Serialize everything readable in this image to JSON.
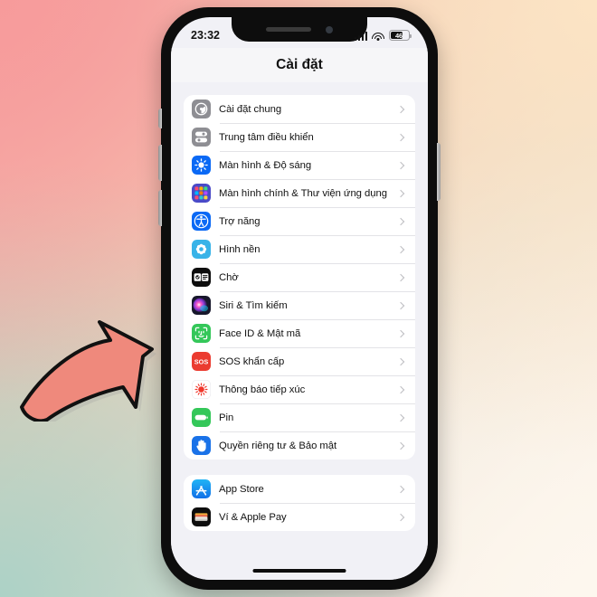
{
  "background": {
    "top_left_color": "#f79b9b",
    "top_right_color": "#fce4c4",
    "bottom_left_color": "#acd2c6",
    "bottom_right_color": "#fdf7ee"
  },
  "phone": {
    "frame_color": "#0d0d0d",
    "screen_bg": "#f1f1f6"
  },
  "status_bar": {
    "time": "23:32",
    "cellular_icon": "cellular-signal-icon",
    "wifi_icon": "wifi-icon",
    "battery_icon": "battery-icon",
    "battery_percent": "46"
  },
  "navbar": {
    "title": "Cài đặt"
  },
  "groups": [
    {
      "rows": [
        {
          "label": "Cài đặt chung",
          "icon": "gear-icon",
          "icon_color": "#8e8e93"
        },
        {
          "label": "Trung tâm điều khiển",
          "icon": "control-center-icon",
          "icon_color": "#8e8e93"
        },
        {
          "label": "Màn hình & Độ sáng",
          "icon": "brightness-icon",
          "icon_color": "#0a69f5"
        },
        {
          "label": "Màn hình chính & Thư viện ứng dụng",
          "icon": "app-library-icon",
          "icon_color": "#5b5bd6"
        },
        {
          "label": "Trợ năng",
          "icon": "accessibility-icon",
          "icon_color": "#0a69f5"
        },
        {
          "label": "Hình nền",
          "icon": "wallpaper-icon",
          "icon_color": "#38b3e8"
        },
        {
          "label": "Chờ",
          "icon": "standby-icon",
          "icon_color": "#0d0d0d"
        },
        {
          "label": "Siri & Tìm kiếm",
          "icon": "siri-icon",
          "icon_color": "#2b2b3a"
        },
        {
          "label": "Face ID & Mật mã",
          "icon": "face-id-icon",
          "icon_color": "#34c759"
        },
        {
          "label": "SOS khẩn cấp",
          "icon": "sos-icon",
          "icon_color": "#eb3b30"
        },
        {
          "label": "Thông báo tiếp xúc",
          "icon": "exposure-notification-icon",
          "icon_color": "#ffffff"
        },
        {
          "label": "Pin",
          "icon": "battery-settings-icon",
          "icon_color": "#34c759"
        },
        {
          "label": "Quyền riêng tư & Bảo mật",
          "icon": "privacy-hand-icon",
          "icon_color": "#1a72e8"
        }
      ]
    },
    {
      "rows": [
        {
          "label": "App Store",
          "icon": "app-store-icon",
          "icon_color": "#1f9bf0"
        },
        {
          "label": "Ví & Apple Pay",
          "icon": "wallet-icon",
          "icon_color": "#0d0d0d"
        }
      ]
    }
  ],
  "annotation": {
    "arrow_name": "pointing-arrow",
    "fill_color": "#ef897c",
    "stroke_color": "#111111",
    "points_to": "Face ID & Mật mã"
  },
  "home_indicator": "home-indicator"
}
